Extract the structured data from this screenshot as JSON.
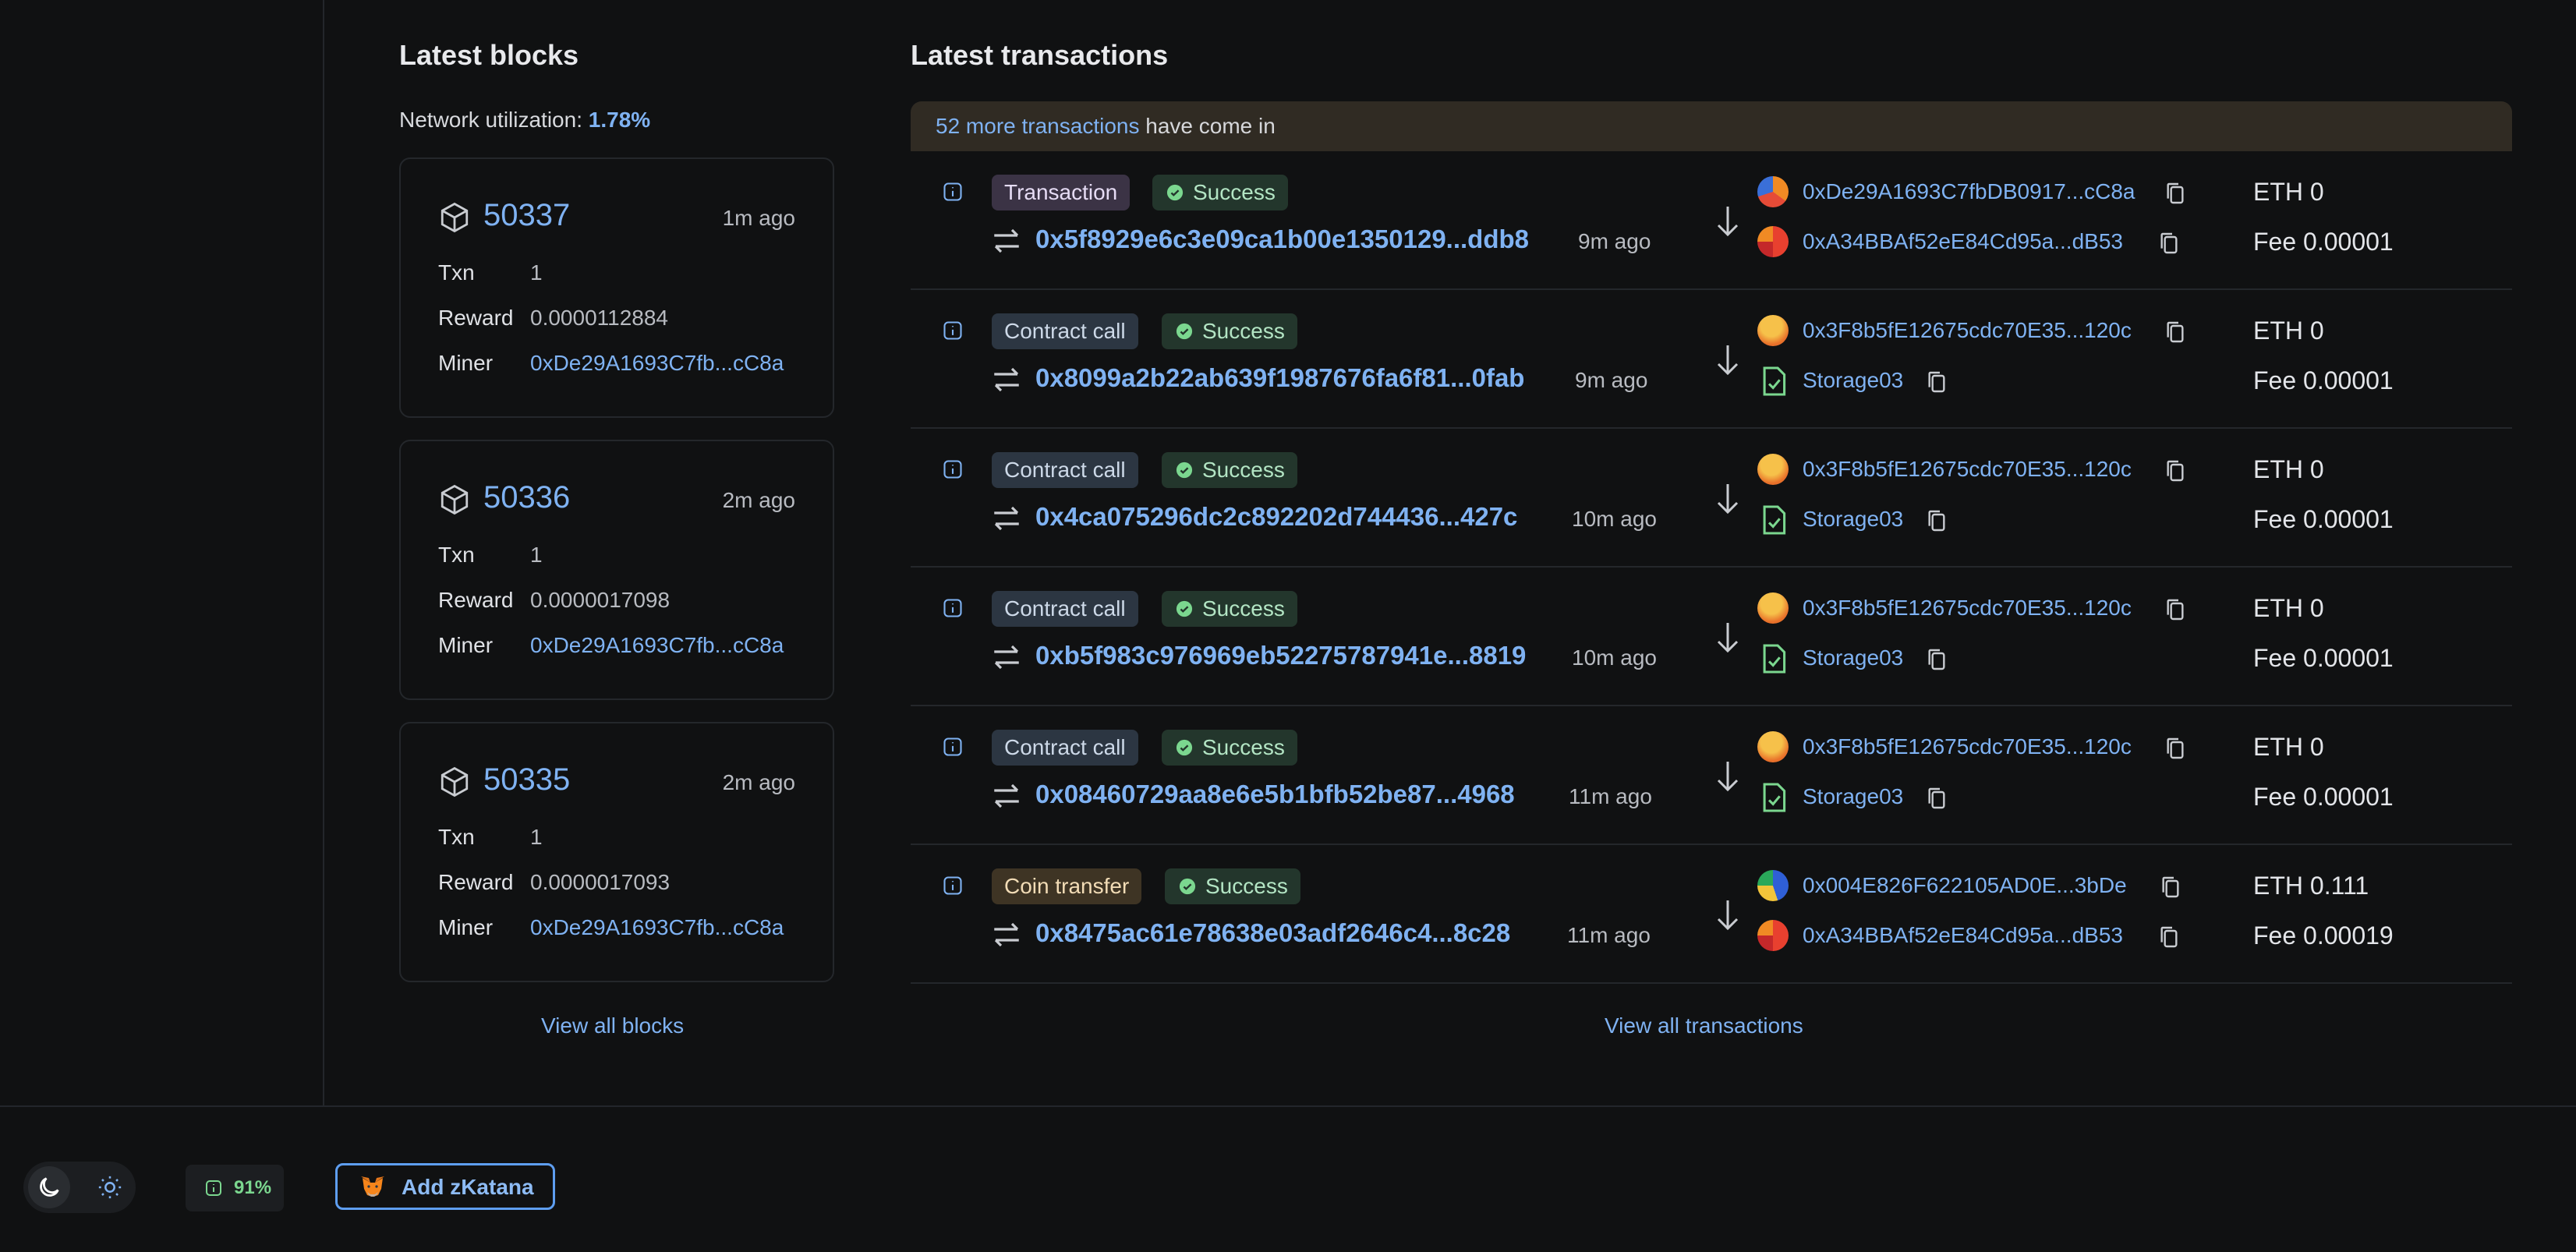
{
  "blocks_section": {
    "title": "Latest blocks",
    "utilization_label": "Network utilization:",
    "utilization_value": "1.78%",
    "labels": {
      "txn": "Txn",
      "reward": "Reward",
      "miner": "Miner"
    },
    "items": [
      {
        "number": "50337",
        "ago": "1m ago",
        "txn": "1",
        "reward": "0.0000112884",
        "miner": "0xDe29A1693C7fb...cC8a"
      },
      {
        "number": "50336",
        "ago": "2m ago",
        "txn": "1",
        "reward": "0.0000017098",
        "miner": "0xDe29A1693C7fb...cC8a"
      },
      {
        "number": "50335",
        "ago": "2m ago",
        "txn": "1",
        "reward": "0.0000017093",
        "miner": "0xDe29A1693C7fb...cC8a"
      }
    ],
    "view_all": "View all blocks"
  },
  "transactions_section": {
    "title": "Latest transactions",
    "banner_link": "52 more transactions",
    "banner_text": " have come in",
    "items": [
      {
        "type": "Transaction",
        "status": "Success",
        "hash": "0x5f8929e6c3e09ca1b00e1350129...ddb8",
        "ago": "9m ago",
        "from": "0xDe29A1693C7fbDB0917...cC8a",
        "to": "0xA34BBAf52eE84Cd95a...dB53",
        "eth": "ETH 0",
        "fee": "Fee 0.00001"
      },
      {
        "type": "Contract call",
        "status": "Success",
        "hash": "0x8099a2b22ab639f1987676fa6f81...0fab",
        "ago": "9m ago",
        "from": "0x3F8b5fE12675cdc70E35...120c",
        "to": "Storage03",
        "eth": "ETH 0",
        "fee": "Fee 0.00001"
      },
      {
        "type": "Contract call",
        "status": "Success",
        "hash": "0x4ca075296dc2c892202d744436...427c",
        "ago": "10m ago",
        "from": "0x3F8b5fE12675cdc70E35...120c",
        "to": "Storage03",
        "eth": "ETH 0",
        "fee": "Fee 0.00001"
      },
      {
        "type": "Contract call",
        "status": "Success",
        "hash": "0xb5f983c976969eb52275787941e...8819",
        "ago": "10m ago",
        "from": "0x3F8b5fE12675cdc70E35...120c",
        "to": "Storage03",
        "eth": "ETH 0",
        "fee": "Fee 0.00001"
      },
      {
        "type": "Contract call",
        "status": "Success",
        "hash": "0x08460729aa8e6e5b1bfb52be87...4968",
        "ago": "11m ago",
        "from": "0x3F8b5fE12675cdc70E35...120c",
        "to": "Storage03",
        "eth": "ETH 0",
        "fee": "Fee 0.00001"
      },
      {
        "type": "Coin transfer",
        "status": "Success",
        "hash": "0x8475ac61e78638e03adf2646c4...8c28",
        "ago": "11m ago",
        "from": "0x004E826F622105AD0E...3bDe",
        "to": "0xA34BBAf52eE84Cd95a...dB53",
        "eth": "ETH 0.111",
        "fee": "Fee 0.00019"
      }
    ],
    "view_all": "View all transactions"
  },
  "footer": {
    "gauge_value": "91%",
    "add_network_label": "Add zKatana"
  },
  "colors": {
    "background": "#101112",
    "link": "#7fb2f2",
    "success_bg": "#23362c",
    "banner_bg": "#302b23"
  }
}
